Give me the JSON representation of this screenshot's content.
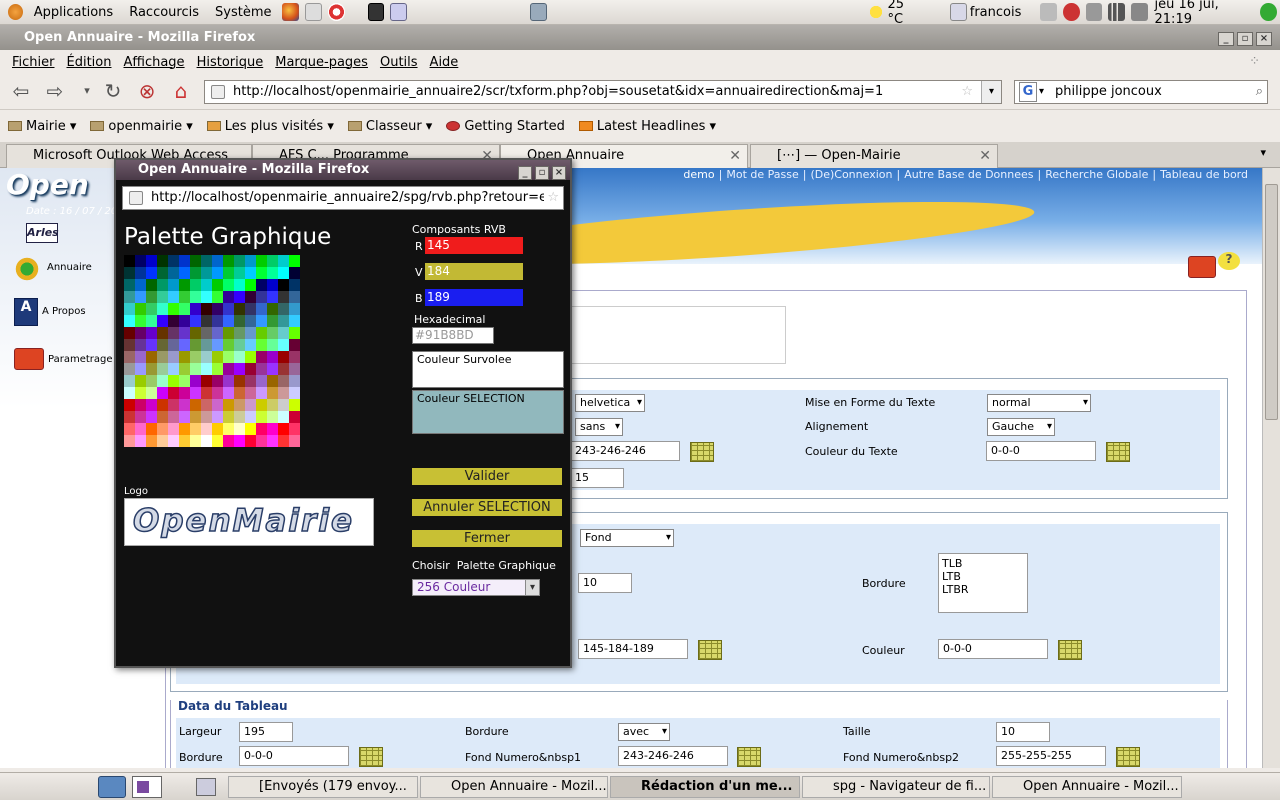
{
  "panel": {
    "applications": "Applications",
    "raccourcis": "Raccourcis",
    "systeme": "Système",
    "temperature": "25 °C",
    "user": "francois",
    "clock": "jeu 16 jui, 21:19"
  },
  "window": {
    "title": "Open Annuaire - Mozilla Firefox"
  },
  "menubar": [
    "Fichier",
    "Édition",
    "Affichage",
    "Historique",
    "Marque-pages",
    "Outils",
    "Aide"
  ],
  "nav": {
    "url": "http://localhost/openmairie_annuaire2/scr/txform.php?obj=sousetat&idx=annuairedirection&maj=1",
    "search": "philippe joncoux",
    "search_engine": "G"
  },
  "bookmarks": [
    "Mairie ▾",
    "openmairie ▾",
    "Les plus visités ▾",
    "Classeur ▾",
    "Getting Started",
    "Latest Headlines ▾"
  ],
  "tabs": [
    "Microsoft Outlook Web Access",
    "AFS C... Programme",
    "Open Annuaire",
    "[⋯] — Open-Mairie"
  ],
  "site": {
    "logo": "Open",
    "date": "Date : 16 / 07 / 20",
    "commune": "Arles",
    "sidebar": [
      "Annuaire",
      "A Propos",
      "Parametrage"
    ],
    "toplinks": [
      "demo",
      "Mot de Passe",
      "(De)Connexion",
      "Autre Base de Donnees",
      "Recherche Globale",
      "Tableau de bord"
    ]
  },
  "form": {
    "s1": {
      "font": "helvetica",
      "style_label": "Mise en Forme du Texte",
      "style": "normal",
      "size": "sans",
      "align_label": "Alignement",
      "align": "Gauche",
      "bg": "243-246-246",
      "color_label": "Couleur du Texte",
      "color": "0-0-0",
      "h": "15"
    },
    "s2": {
      "fond": "Fond",
      "v10": "10",
      "bordure_label": "Bordure",
      "bordures": [
        "TLB",
        "LTB",
        "LTBR"
      ],
      "rgb": "145-184-189",
      "couleur_label": "Couleur",
      "couleur": "0-0-0"
    },
    "s3": {
      "title": "Data du Tableau",
      "largeur_label": "Largeur",
      "largeur": "195",
      "bordure_label": "Bordure",
      "bordure_sel": "avec",
      "taille_label": "Taille",
      "taille": "10",
      "bordure2_label": "Bordure",
      "bordure2": "0-0-0",
      "fond1_label": "Fond Numero&nbsp1",
      "fond1": "243-246-246",
      "fond2_label": "Fond Numero&nbsp2",
      "fond2": "255-255-255"
    }
  },
  "popup": {
    "title": "Open Annuaire - Mozilla Firefox",
    "url": "http://localhost/openmairie_annuaire2/spg/rvb.php?retour=e",
    "heading": "Palette Graphique",
    "rvb_title": "Composants RVB",
    "r_label": "R",
    "r": "145",
    "v_label": "V",
    "v": "184",
    "b_label": "B",
    "b": "189",
    "hex_label": "Hexadecimal",
    "hex": "#91B8BD",
    "survol_label": "Couleur Survolee",
    "selection_label": "Couleur SELECTION",
    "valider": "Valider",
    "annuler": "Annuler SELECTION",
    "fermer": "Fermer",
    "logo_label": "Logo",
    "logo_text": "OpenMairie",
    "choose_label": "Choisir  Palette Graphique",
    "choose": "256 Couleur",
    "selection_color": "#91B8BD"
  },
  "taskbar": [
    "[Envoyés (179 envoy...",
    "Open Annuaire - Mozil...",
    "Rédaction d'un me...",
    "spg - Navigateur de fi...",
    "Open Annuaire - Mozil..."
  ]
}
